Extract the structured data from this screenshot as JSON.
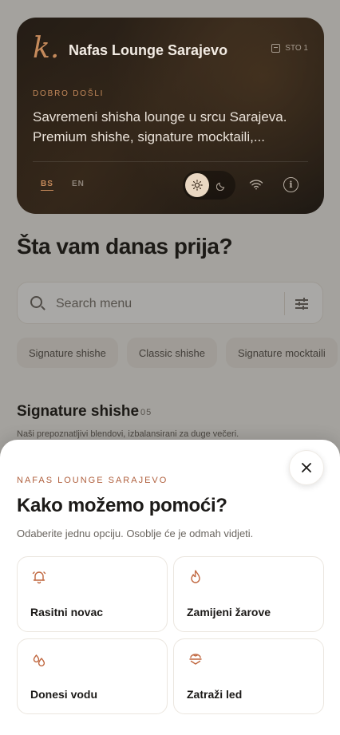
{
  "hero": {
    "logo": "k.",
    "venue_name": "Nafas Lounge Sarajevo",
    "table": "STO 1",
    "welcome": "DOBRO DOŠLI",
    "description": "Savremeni shisha lounge u srcu Sarajeva. Premium shishe, signature mocktaili,...",
    "languages": [
      "BS",
      "EN"
    ],
    "active_language": "BS",
    "theme_light_icon": "sun-icon",
    "theme_dark_icon": "moon-icon",
    "wifi_icon": "wifi-icon",
    "info_icon": "info-icon"
  },
  "main": {
    "question": "Šta vam danas prija?",
    "search_placeholder": "Search menu",
    "categories": [
      "Signature shishe",
      "Classic shishe",
      "Signature mocktaili"
    ],
    "section": {
      "title": "Signature shishe",
      "count": "05",
      "subtitle": "Naši prepoznatljivi blendovi, izbalansirani za duge večeri."
    }
  },
  "sheet": {
    "kicker": "NAFAS LOUNGE SARAJEVO",
    "title": "Kako možemo pomoći?",
    "subtitle": "Odaberite jednu opciju. Osoblje će je odmah vidjeti.",
    "options": [
      {
        "label": "Rasitni novac",
        "icon": "bell-icon"
      },
      {
        "label": "Zamijeni žarove",
        "icon": "flame-icon"
      },
      {
        "label": "Donesi vodu",
        "icon": "water-drops-icon"
      },
      {
        "label": "Zatraži led",
        "icon": "ice-icon"
      }
    ]
  },
  "colors": {
    "accent": "#c0673f",
    "hero_bg": "#2a1f16"
  }
}
